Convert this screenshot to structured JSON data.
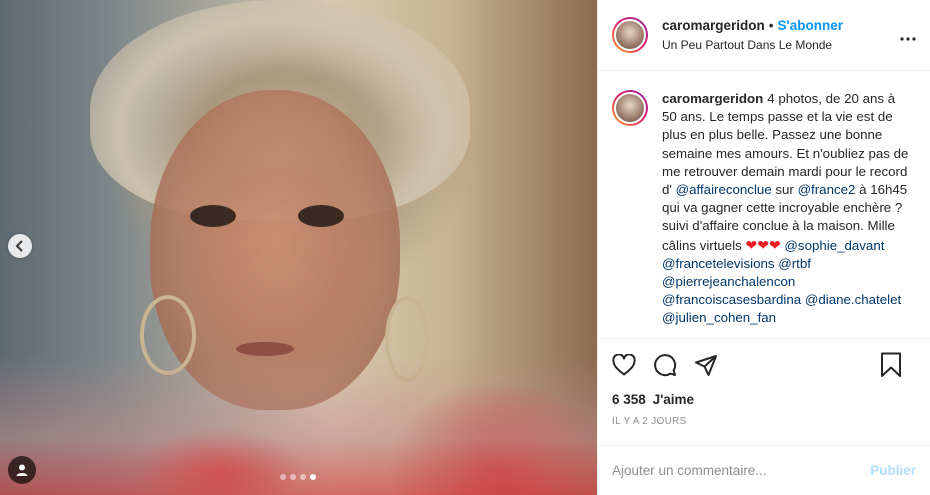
{
  "header": {
    "username": "caromargeridon",
    "separator": "•",
    "follow_label": "S'abonner",
    "location": "Un Peu Partout Dans Le Monde",
    "more_icon": "more-horizontal-icon"
  },
  "media": {
    "carousel_dots": 4,
    "active_dot": 4,
    "prev_icon": "chevron-left-icon",
    "tag_icon": "user-tag-icon"
  },
  "caption": {
    "username": "caromargeridon",
    "text_1": "4 photos, de 20 ans à 50 ans. Le temps passe et la vie est de plus en plus belle. Passez une bonne semaine mes amours. Et n'oubliez pas de me retrouver demain mardi pour le record d' ",
    "mention_1": "@affaireconclue",
    "text_2": " sur ",
    "mention_2": "@france2",
    "text_3": " à 16h45 qui va gagner cette incroyable enchère ? suivi d'affaire conclue à la maison. Mille câlins virtuels ",
    "hearts": "❤❤❤",
    "mention_3": "@sophie_davant",
    "mention_4": "@francetelevisions",
    "mention_5": "@rtbf",
    "mention_6": "@pierrejeanchalencon",
    "mention_7": "@francoiscasesbardina",
    "mention_8": "@diane.chatelet",
    "mention_9": "@julien_cohen_fan"
  },
  "actions": {
    "like_icon": "heart-icon",
    "comment_icon": "comment-icon",
    "share_icon": "share-icon",
    "save_icon": "bookmark-icon"
  },
  "likes": {
    "count": "6 358",
    "label": "J'aime"
  },
  "timestamp": "IL Y A 2 JOURS",
  "comment_box": {
    "placeholder": "Ajouter un commentaire...",
    "publish_label": "Publier"
  },
  "colors": {
    "link_blue": "#0095f6",
    "mention_blue": "#00376b",
    "publish_disabled": "#b2dffc",
    "heart_red": "#ed1c24"
  }
}
